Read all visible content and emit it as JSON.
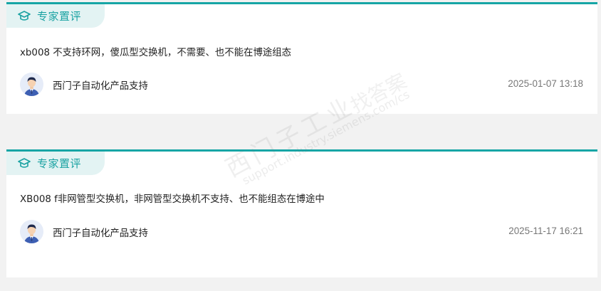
{
  "reviews": [
    {
      "tag_label": "专家置评",
      "comment": "xb008 不支持环网，傻瓜型交换机，不需要、也不能在博途组态",
      "author": "西门子自动化产品支持",
      "timestamp": "2025-01-07 13:18"
    },
    {
      "tag_label": "专家置评",
      "comment": "XB008 f非网管型交换机，非网管型交换机不支持、也不能组态在博途中",
      "author": "西门子自动化产品支持",
      "timestamp": "2025-11-17 16:21"
    }
  ],
  "watermark": {
    "brand": "西门子工业",
    "tagline": "找答案",
    "url": "support.industry.siemens.com/cs"
  },
  "colors": {
    "accent": "#16a5a5",
    "tag_bg": "#e3f3f3",
    "tag_text": "#1aa2a2",
    "page_bg": "#f2f2f2"
  },
  "icons": {
    "tag_icon": "graduation-cap-icon",
    "avatar": "support-agent-avatar"
  }
}
